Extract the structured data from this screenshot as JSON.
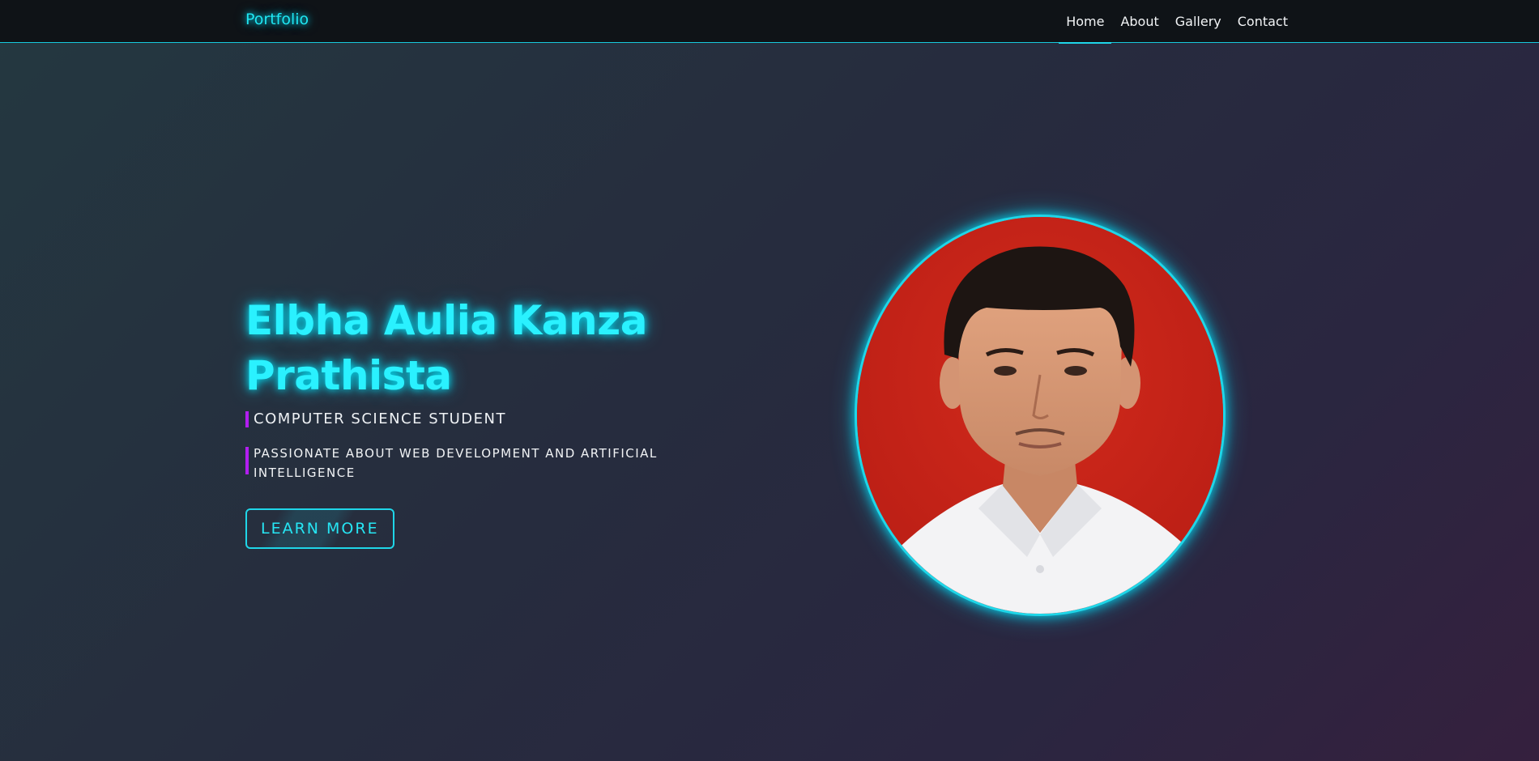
{
  "navbar": {
    "brand": "Portfolio",
    "links": [
      {
        "label": "Home",
        "active": true
      },
      {
        "label": "About",
        "active": false
      },
      {
        "label": "Gallery",
        "active": false
      },
      {
        "label": "Contact",
        "active": false
      }
    ]
  },
  "hero": {
    "name": "Elbha Aulia Kanza Prathista",
    "role": "COMPUTER SCIENCE STUDENT",
    "tagline": "PASSIONATE ABOUT WEB DEVELOPMENT AND ARTIFICIAL INTELLIGENCE",
    "button_label": "LEARN MORE"
  },
  "colors": {
    "accent": "#1fd6e8",
    "accent_secondary": "#b21ef0",
    "nav_background": "#0f1317",
    "photo_background": "#c9231a"
  }
}
